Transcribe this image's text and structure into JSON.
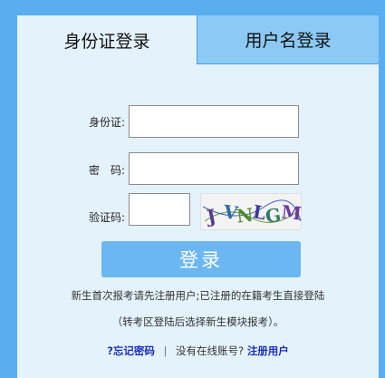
{
  "tabs": [
    {
      "label": "身份证登录",
      "active": true
    },
    {
      "label": "用户名登录",
      "active": false
    }
  ],
  "form": {
    "id_label": "身份证:",
    "password_label": "密　码:",
    "captcha_label": "验证码:",
    "id_value": "",
    "password_value": "",
    "captcha_value": "",
    "captcha_text": "JVNLGM"
  },
  "login_button": "登录",
  "notes": {
    "line1": "新生首次报考请先注册用户;已注册的在籍考生直接登陆",
    "line2": "（转考区登陆后选择新生模块报考）。"
  },
  "links": {
    "forgot": "?忘记密码",
    "separator": "|",
    "no_account": "没有在线账号?",
    "register": "注册用户"
  },
  "colors": {
    "frame": "#5aaef0",
    "panel": "#e4f2fc",
    "inactive_tab": "#8ccaf5",
    "button": "#6cb7f2",
    "link": "#1a2fb5"
  }
}
